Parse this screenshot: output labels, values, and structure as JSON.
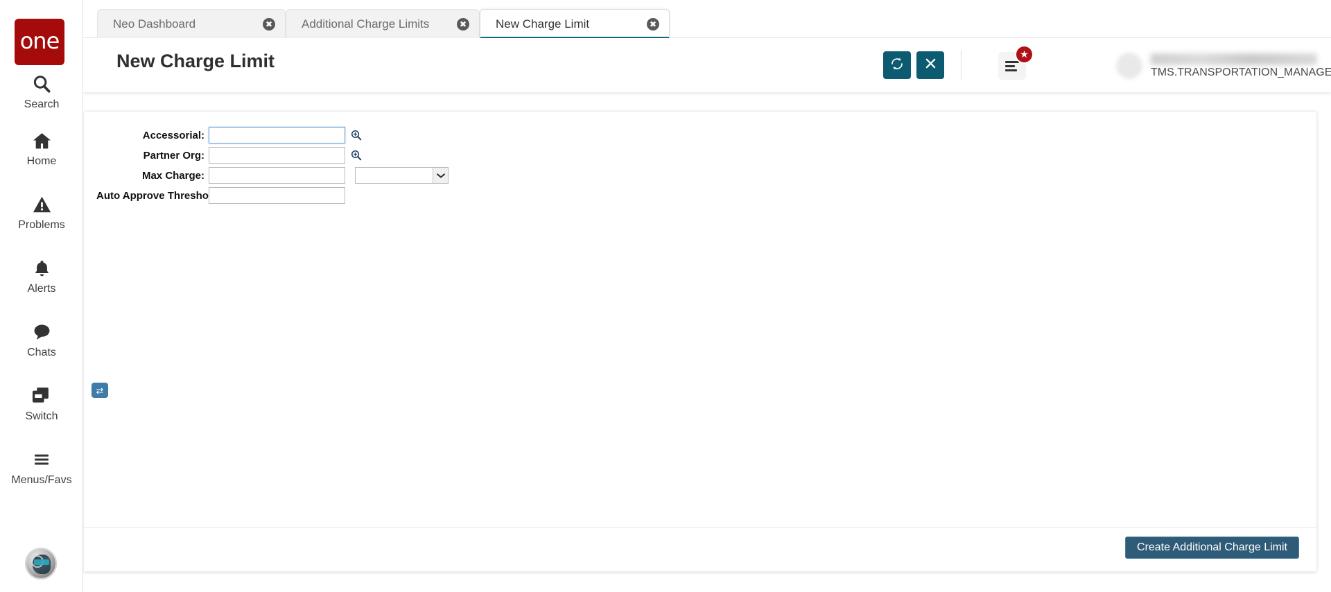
{
  "sidebar": {
    "logo_text": "one",
    "items": [
      {
        "label": "Search",
        "icon": "search-icon"
      },
      {
        "label": "Home",
        "icon": "home-icon"
      },
      {
        "label": "Problems",
        "icon": "warning-triangle-icon"
      },
      {
        "label": "Alerts",
        "icon": "bell-icon"
      },
      {
        "label": "Chats",
        "icon": "chat-bubble-icon"
      },
      {
        "label": "Switch",
        "icon": "switch-windows-icon"
      },
      {
        "label": "Menus/Favs",
        "icon": "hamburger-icon"
      }
    ]
  },
  "tabs": [
    {
      "label": "Neo Dashboard",
      "active": false,
      "close": "✖"
    },
    {
      "label": "Additional Charge Limits",
      "active": false,
      "close": "✖"
    },
    {
      "label": "New Charge Limit",
      "active": true,
      "close": "✖"
    }
  ],
  "header": {
    "title": "New Charge Limit",
    "refresh_icon": "refresh-icon",
    "close_icon": "close-x-icon",
    "menu_icon": "list-menu-icon",
    "badge_icon": "star-icon",
    "user_login": "TMS.TRANSPORTATION_MANAGER",
    "user_caret_icon": "chevron-down-icon"
  },
  "form": {
    "fields": [
      {
        "label": "Accessorial:",
        "value": "",
        "type": "text-lookup",
        "focused": true,
        "lookup_icon": "magnifier-plus-icon"
      },
      {
        "label": "Partner Org:",
        "value": "",
        "type": "text-lookup",
        "focused": false,
        "lookup_icon": "magnifier-plus-icon"
      },
      {
        "label": "Max Charge:",
        "value": "",
        "type": "text-select",
        "focused": false,
        "select_value": "",
        "select_caret_icon": "chevron-down-icon"
      },
      {
        "label": "Auto Approve Threshold:",
        "value": "",
        "type": "text",
        "focused": false
      }
    ]
  },
  "footer": {
    "create_label": "Create Additional Charge Limit"
  },
  "colors": {
    "brand_red": "#a50b0b",
    "teal_button": "#0d5b70",
    "active_tab_underline": "#0d6a80",
    "primary_button": "#2e5c78",
    "badge_red": "#b01116",
    "switch_badge_blue": "#3f7da8"
  }
}
